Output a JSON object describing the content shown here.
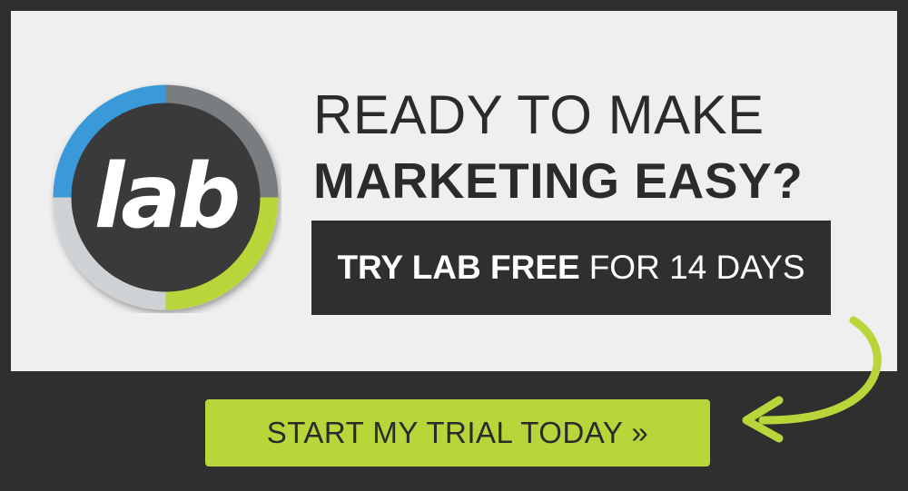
{
  "logo": {
    "text": "lab",
    "ring_colors": {
      "top_left": "#3a9ad9",
      "top_right": "#7a7d80",
      "bottom_right": "#b8d63a",
      "bottom_left": "#cfd2d4"
    }
  },
  "headline": {
    "line1": "READY TO MAKE",
    "line2": "MARKETING EASY?"
  },
  "offer": {
    "strong": "TRY LAB FREE",
    "rest": "FOR 14 DAYS"
  },
  "cta": {
    "label": "START MY TRIAL TODAY »"
  },
  "colors": {
    "background": "#2f2f2f",
    "panel": "#efefef",
    "accent_green": "#b8d63a",
    "accent_blue": "#3a9ad9",
    "text_dark": "#2b2b2b"
  },
  "icons": {
    "arrow": "curved-arrow-icon"
  }
}
